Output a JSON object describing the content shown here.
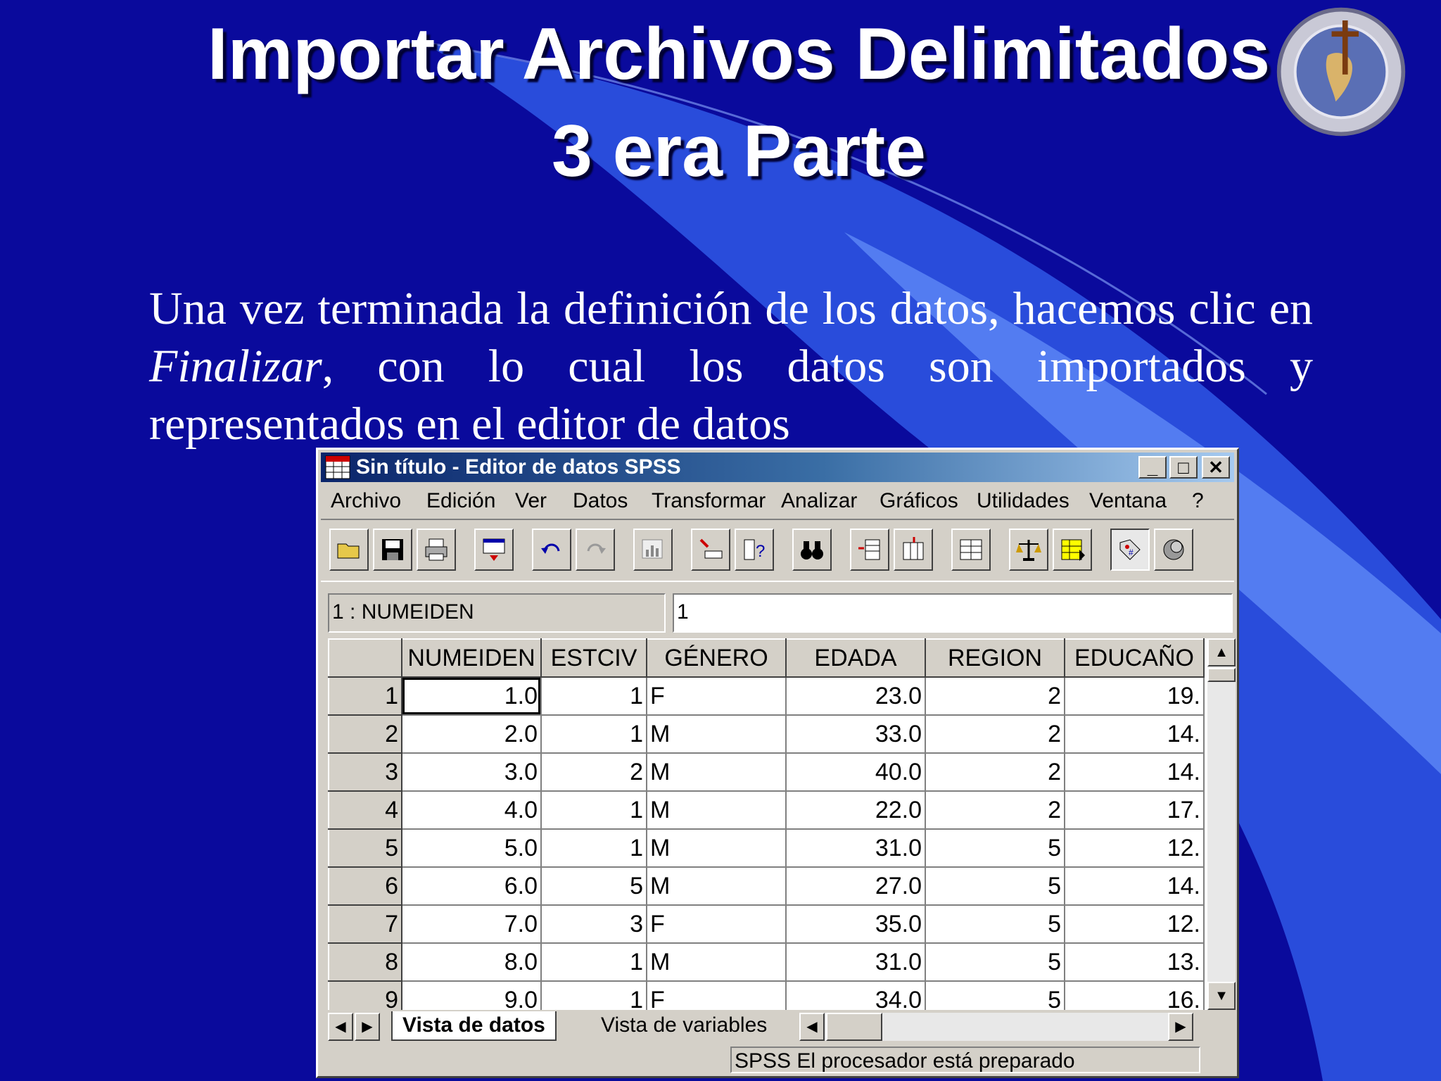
{
  "slide": {
    "title_line1": "Importar Archivos Delimitados",
    "title_line2": "3 era Parte",
    "body_part1": "Una vez terminada la definición de los datos, hacemos clic en ",
    "body_emphasis": "Finalizar",
    "body_part2": ", con lo cual los datos son importados y representados en el editor de datos",
    "seal_icon": "university-seal-icon"
  },
  "window": {
    "title": "Sin título - Editor de datos SPSS",
    "app_icon": "spss-data-editor-icon",
    "minimize": "_",
    "maximize": "□",
    "close": "✕",
    "menus": [
      "Archivo",
      "Edición",
      "Ver",
      "Datos",
      "Transformar",
      "Analizar",
      "Gráficos",
      "Utilidades",
      "Ventana",
      "?"
    ],
    "toolbar_icons": [
      "open-folder-icon",
      "save-icon",
      "print-icon",
      "dialog-recall-icon",
      "undo-icon",
      "redo-icon",
      "goto-chart-icon",
      "goto-case-icon",
      "variables-icon",
      "find-icon",
      "insert-case-icon",
      "insert-variable-icon",
      "split-file-icon",
      "weight-cases-icon",
      "select-cases-icon",
      "value-labels-icon",
      "use-sets-icon"
    ],
    "cell_reference": "1 : NUMEIDEN",
    "cell_value": "1",
    "columns": [
      "NUMEIDEN",
      "ESTCIV",
      "GÉNERO",
      "EDADA",
      "REGION",
      "EDUCAÑO"
    ],
    "rows": [
      {
        "n": "1",
        "cells": [
          "1.0",
          "1",
          "F",
          "23.0",
          "2",
          "19."
        ]
      },
      {
        "n": "2",
        "cells": [
          "2.0",
          "1",
          "M",
          "33.0",
          "2",
          "14."
        ]
      },
      {
        "n": "3",
        "cells": [
          "3.0",
          "2",
          "M",
          "40.0",
          "2",
          "14."
        ]
      },
      {
        "n": "4",
        "cells": [
          "4.0",
          "1",
          "M",
          "22.0",
          "2",
          "17."
        ]
      },
      {
        "n": "5",
        "cells": [
          "5.0",
          "1",
          "M",
          "31.0",
          "5",
          "12."
        ]
      },
      {
        "n": "6",
        "cells": [
          "6.0",
          "5",
          "M",
          "27.0",
          "5",
          "14."
        ]
      },
      {
        "n": "7",
        "cells": [
          "7.0",
          "3",
          "F",
          "35.0",
          "5",
          "12."
        ]
      },
      {
        "n": "8",
        "cells": [
          "8.0",
          "1",
          "M",
          "31.0",
          "5",
          "13."
        ]
      },
      {
        "n": "9",
        "cells": [
          "9.0",
          "1",
          "F",
          "34.0",
          "5",
          "16."
        ]
      }
    ],
    "tabs": [
      "Vista de datos",
      "Vista de variables"
    ],
    "active_tab": "Vista de datos",
    "status": "SPSS El procesador  está preparado"
  },
  "colors": {
    "slide_background": "#0a0a9c",
    "sweep": "#3a6ff0",
    "titlebar_start": "#0a246a",
    "titlebar_end": "#a6caf0",
    "window_face": "#d4d0c8"
  }
}
